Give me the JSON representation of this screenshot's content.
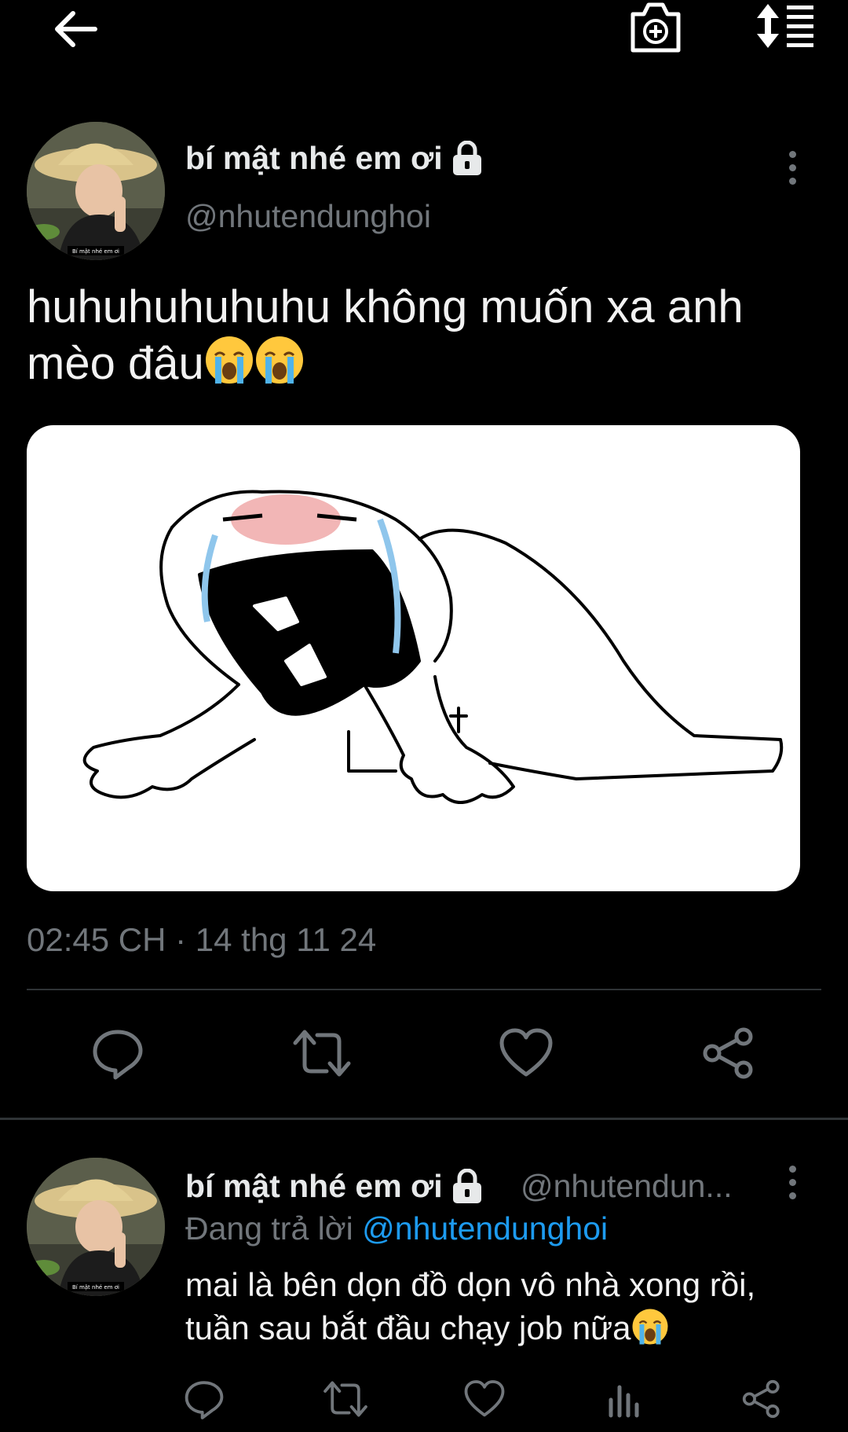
{
  "topbar": {
    "back_icon": "arrow-left-icon",
    "camera_icon": "camera-add-icon",
    "sort_icon": "sort-list-icon"
  },
  "tweet": {
    "display_name": "bí mật nhé em ơi",
    "handle": "@nhutendunghoi",
    "text": "huhuhuhuhuhu không muốn xa anh mèo đâu",
    "emoji": "crying-face-emoji",
    "timestamp": "02:45 CH · 14 thg 11 24",
    "avatar_caption": "Bí mật nhé em ơi",
    "actions": [
      "reply-icon",
      "retweet-icon",
      "like-icon",
      "share-icon"
    ]
  },
  "reply": {
    "display_name": "bí mật nhé em ơi",
    "handle": "@nhutendun...",
    "replying_to_label": "Đang trả lời",
    "replying_to_handle": "@nhutendunghoi",
    "text": "mai là bên dọn đồ dọn vô nhà xong rồi, tuần sau bắt đầu chạy job nữa",
    "avatar_caption": "Bí mật nhé em ơi",
    "actions": [
      "reply-icon",
      "retweet-icon",
      "like-icon",
      "views-icon",
      "share-icon"
    ]
  },
  "colors": {
    "background": "#000000",
    "text": "#e7e9ea",
    "muted": "#71767b",
    "accent": "#1d9bf0",
    "divider": "#2f3336"
  }
}
